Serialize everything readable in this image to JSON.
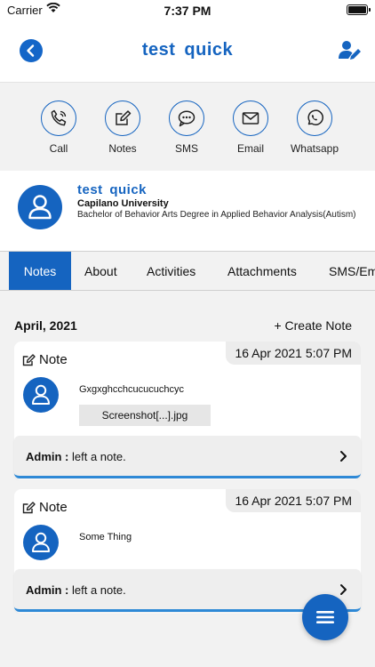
{
  "status_bar": {
    "carrier": "Carrier",
    "time": "7:37 PM"
  },
  "nav": {
    "title": "test  quick",
    "back_icon": "chevron-left-icon",
    "right_icon": "user-edit-icon"
  },
  "actions": [
    {
      "label": "Call",
      "icon": "phone-icon"
    },
    {
      "label": "Notes",
      "icon": "edit-icon"
    },
    {
      "label": "SMS",
      "icon": "chat-bubble-icon"
    },
    {
      "label": "Email",
      "icon": "envelope-icon"
    },
    {
      "label": "Whatsapp",
      "icon": "whatsapp-icon"
    }
  ],
  "profile": {
    "name": "test  quick",
    "organization": "Capilano University",
    "degree": "Bachelor of Behavior Arts Degree in Applied Behavior Analysis(Autism)"
  },
  "tabs": [
    "Notes",
    "About",
    "Activities",
    "Attachments",
    "SMS/Em"
  ],
  "active_tab": "Notes",
  "notes_section": {
    "month": "April, 2021",
    "create_label": "Create Note",
    "create_prefix": "+"
  },
  "notes": [
    {
      "type_label": "Note",
      "date": "16 Apr 2021 5:07 PM",
      "text": "Gxgxghcchcucucuchcyc",
      "attachment": "Screenshot[...].jpg",
      "footer_author": "Admin :",
      "footer_action": "left a note."
    },
    {
      "type_label": "Note",
      "date": "16 Apr 2021 5:07 PM",
      "text": "Some Thing",
      "footer_author": "Admin :",
      "footer_action": "left a note."
    }
  ],
  "colors": {
    "primary": "#1564c0",
    "accent_line": "#2e89d6",
    "background": "#f2f2f2"
  }
}
